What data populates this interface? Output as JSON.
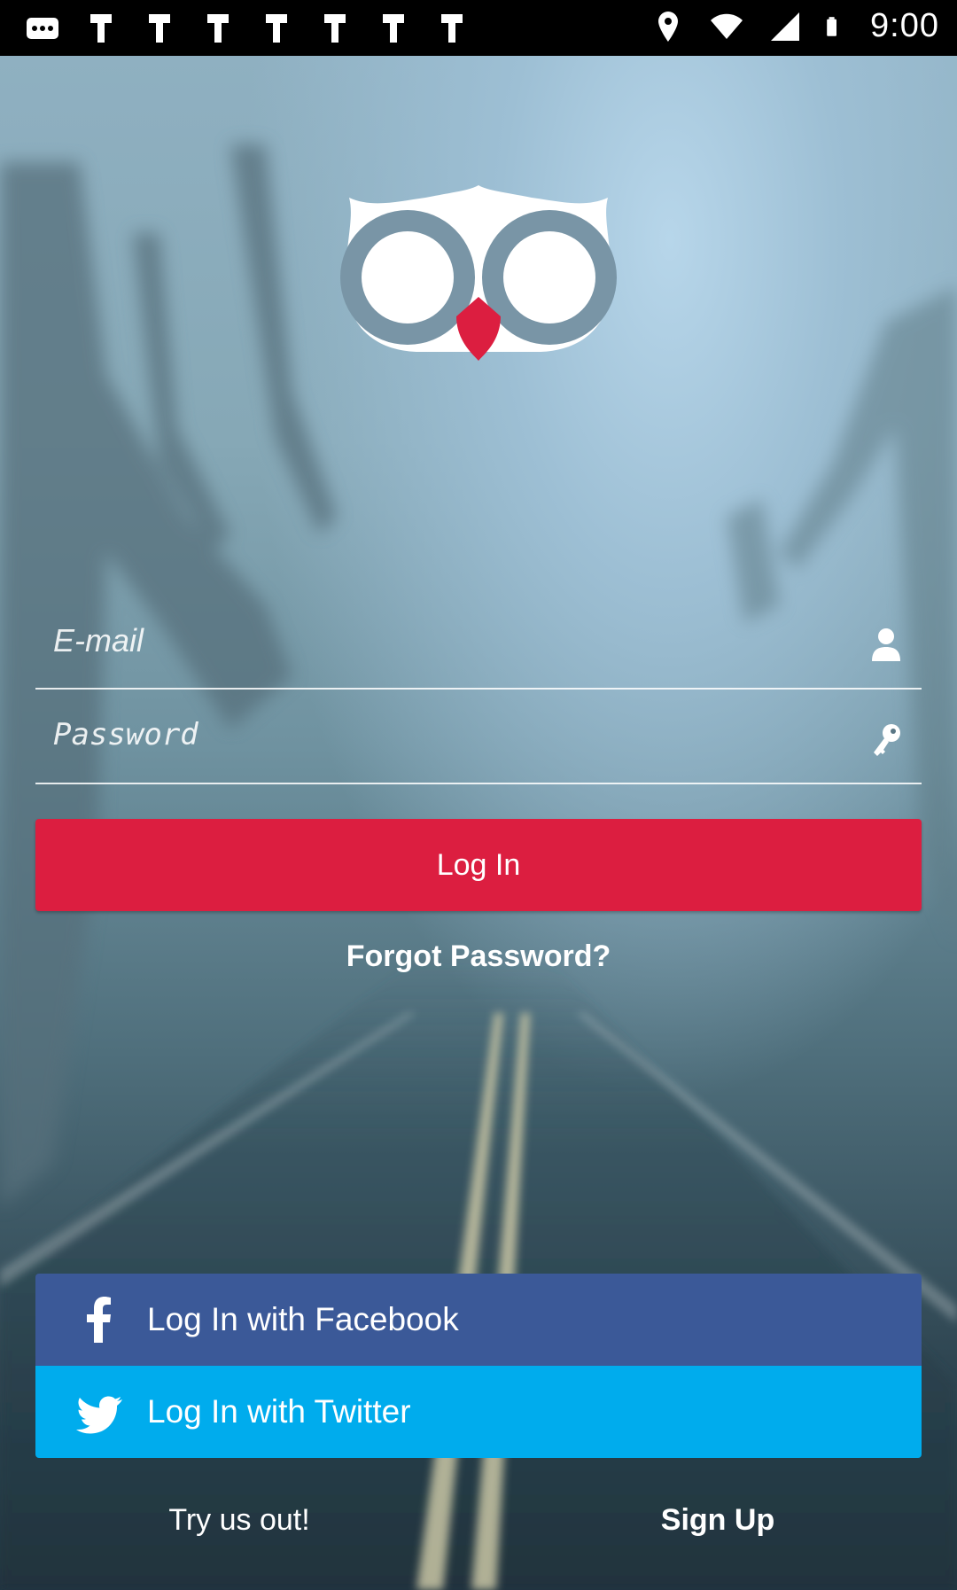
{
  "status_bar": {
    "time": "9:00",
    "icons": [
      "more-icon",
      "notification-icon",
      "notification-icon",
      "notification-icon",
      "notification-icon",
      "notification-icon",
      "notification-icon",
      "notification-icon",
      "location-icon",
      "wifi-icon",
      "signal-icon",
      "battery-icon"
    ]
  },
  "login_form": {
    "email_placeholder": "E-mail",
    "password_placeholder": "Password",
    "login_label": "Log In",
    "forgot_label": "Forgot Password?"
  },
  "social": {
    "facebook_label": "Log In with Facebook",
    "twitter_label": "Log In with Twitter"
  },
  "footer": {
    "try_label": "Try us out!",
    "signup_label": "Sign Up"
  },
  "colors": {
    "login": "#dc1e40",
    "facebook": "#3b5998",
    "twitter": "#00aced"
  }
}
